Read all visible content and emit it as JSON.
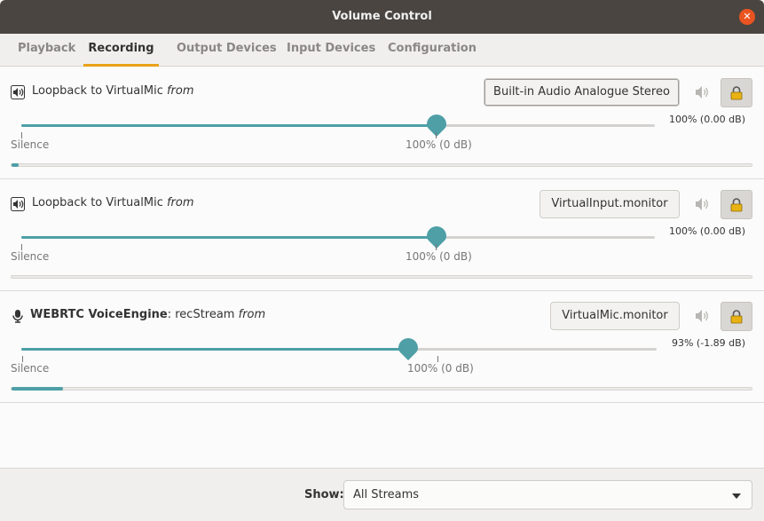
{
  "window": {
    "title": "Volume Control"
  },
  "tabs": [
    {
      "label": "Playback"
    },
    {
      "label": "Recording"
    },
    {
      "label": "Output Devices"
    },
    {
      "label": "Input Devices"
    },
    {
      "label": "Configuration"
    }
  ],
  "active_tab": "Recording",
  "streams": [
    {
      "icon": "speaker-icon",
      "app": "",
      "sep": "",
      "title": "Loopback to VirtualMic",
      "from": "from",
      "device": "Built-in Audio Analogue Stereo",
      "volume_percent": 100,
      "level_text": "100% (0.00 dB)",
      "peak": 0.01,
      "silence_label": "Silence",
      "mark_label": "100% (0 dB)"
    },
    {
      "icon": "speaker-icon",
      "app": "",
      "sep": "",
      "title": "Loopback to VirtualMic",
      "from": "from",
      "device": "VirtualInput.monitor",
      "volume_percent": 100,
      "level_text": "100% (0.00 dB)",
      "peak": 0,
      "silence_label": "Silence",
      "mark_label": "100% (0 dB)"
    },
    {
      "icon": "microphone-icon",
      "app": "WEBRTC VoiceEngine",
      "sep": ": ",
      "title": "recStream",
      "from": "from",
      "device": "VirtualMic.monitor",
      "volume_percent": 93,
      "level_text": "93% (-1.89 dB)",
      "peak": 0.07,
      "silence_label": "Silence",
      "mark_label": "100% (0 dB)"
    }
  ],
  "footer": {
    "show_label": "Show:",
    "show_value": "All Streams"
  },
  "colors": {
    "accent": "#4e9fa6",
    "tab_underline": "#e9a118",
    "close": "#e95420",
    "titlebar": "#4a4541"
  }
}
